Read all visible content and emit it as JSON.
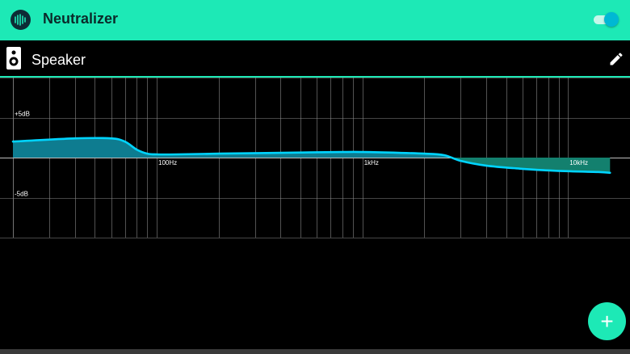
{
  "app": {
    "title": "Neutralizer",
    "logo_icon": "waveform-icon",
    "enabled": true,
    "accent_color": "#1de9b6",
    "curve_color": "#00d4ff"
  },
  "device": {
    "name": "Speaker",
    "icon": "speaker-icon",
    "edit_icon": "pencil-icon"
  },
  "chart_data": {
    "type": "line",
    "xscale": "log",
    "xlim": [
      20,
      20000
    ],
    "ylim": [
      -10,
      10
    ],
    "grid": true,
    "y_tick_labels": [
      {
        "value": 5,
        "label": "+5dB"
      },
      {
        "value": -5,
        "label": "-5dB"
      }
    ],
    "x_tick_labels": [
      {
        "value": 100,
        "label": "100Hz"
      },
      {
        "value": 1000,
        "label": "1kHz"
      },
      {
        "value": 10000,
        "label": "10kHz"
      }
    ],
    "series": [
      {
        "x": [
          20,
          40,
          60,
          70,
          80,
          90,
          100,
          125,
          200,
          400,
          800,
          1000,
          1500,
          2000,
          2500,
          3000,
          4000,
          6000,
          8000,
          10000,
          14000,
          16000
        ],
        "y": [
          2.0,
          2.4,
          2.4,
          2.0,
          1.0,
          0.5,
          0.4,
          0.4,
          0.5,
          0.6,
          0.7,
          0.7,
          0.6,
          0.5,
          0.3,
          -0.4,
          -1.0,
          -1.4,
          -1.6,
          -1.7,
          -1.8,
          -1.9
        ]
      }
    ]
  },
  "fab": {
    "label": "+",
    "action": "add"
  }
}
